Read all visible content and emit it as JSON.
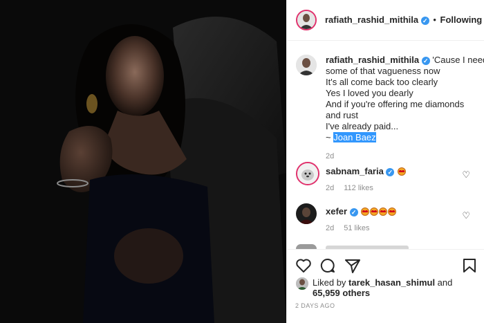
{
  "post": {
    "header": {
      "username": "rafiath_rashid_mithila",
      "verified_glyph": "✓",
      "separator": "•",
      "follow_label": "Following"
    },
    "caption": {
      "username": "rafiath_rashid_mithila",
      "lines": [
        "'Cause I need",
        "some of that vagueness now",
        "It's all come back too clearly",
        "Yes I loved you dearly",
        "And if you're offering me diamonds",
        "and rust",
        "I've already paid...",
        "~ "
      ],
      "highlight": "Joan Baez",
      "time": "2d"
    },
    "comments": [
      {
        "username": "sabnam_faria",
        "emoji_count": 1,
        "time": "2d",
        "likes": "112 likes",
        "avatar_icon": "dog-avatar"
      },
      {
        "username": "xefer",
        "emoji_count": 4,
        "time": "2d",
        "likes": "51 likes",
        "avatar_icon": "dark-avatar"
      }
    ],
    "liked_by": {
      "prefix": "Liked by ",
      "user": "tarek_hasan_shimul",
      "and": " and",
      "count": "65,959 others"
    },
    "posted_ago": "2 DAYS AGO",
    "icons": [
      "heart-icon",
      "comment-icon",
      "share-icon",
      "bookmark-icon",
      "verified-badge-icon"
    ],
    "colors": {
      "verified": "#3897f0",
      "highlight": "#3297fd",
      "muted": "#8e8e8e",
      "text": "#262626"
    }
  }
}
